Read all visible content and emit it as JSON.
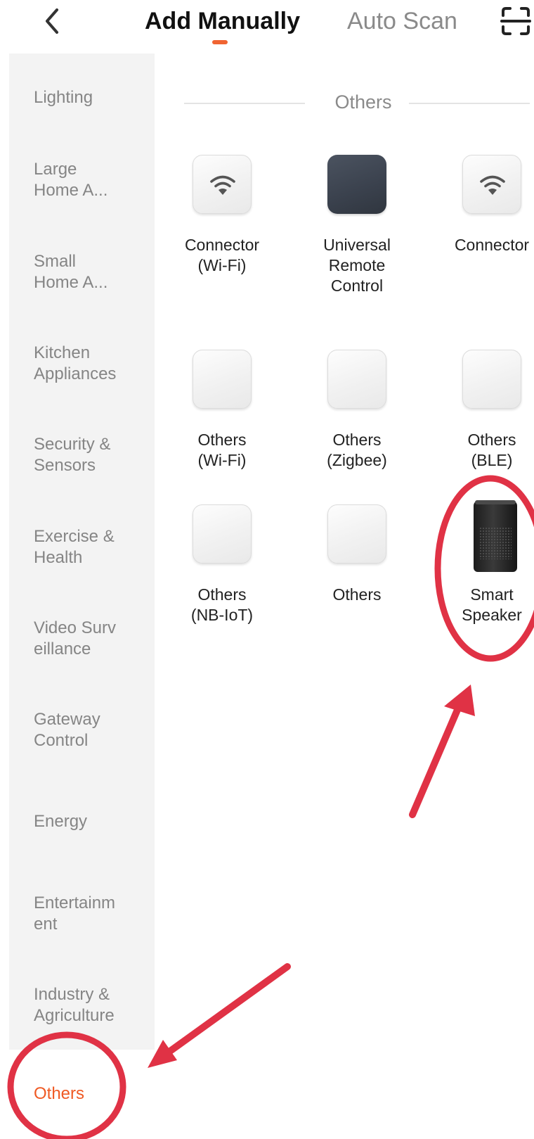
{
  "header": {
    "back_icon": "chevron-left-icon",
    "tabs": [
      {
        "label": "Add Manually",
        "active": true
      },
      {
        "label": "Auto Scan",
        "active": false
      }
    ],
    "scan_icon": "scan-frame-icon",
    "accent_color": "#f06432"
  },
  "sidebar": {
    "items": [
      {
        "label": "Lighting"
      },
      {
        "label": "Large\nHome A..."
      },
      {
        "label": "Small\nHome A..."
      },
      {
        "label": "Kitchen\nAppliances"
      },
      {
        "label": "Security &\nSensors"
      },
      {
        "label": "Exercise &\nHealth"
      },
      {
        "label": "Video Surv\neillance"
      },
      {
        "label": "Gateway\nControl"
      },
      {
        "label": "Energy"
      },
      {
        "label": "Entertainm\nent"
      },
      {
        "label": "Industry &\nAgriculture"
      },
      {
        "label": "Others",
        "selected": true
      }
    ]
  },
  "main": {
    "section_title": "Others",
    "devices": [
      {
        "label": "Connector\n(Wi-Fi)",
        "icon": "wifi-icon"
      },
      {
        "label": "Universal\nRemote\nControl",
        "icon": "remote-tile-icon"
      },
      {
        "label": "Connector",
        "icon": "wifi-icon"
      },
      {
        "label": "Others\n(Wi-Fi)",
        "icon": "blank-tile-icon"
      },
      {
        "label": "Others\n(Zigbee)",
        "icon": "blank-tile-icon"
      },
      {
        "label": "Others\n(BLE)",
        "icon": "blank-tile-icon"
      },
      {
        "label": "Others\n(NB-IoT)",
        "icon": "blank-tile-icon"
      },
      {
        "label": "Others",
        "icon": "blank-tile-icon"
      },
      {
        "label": "Smart\nSpeaker",
        "icon": "smart-speaker-icon"
      }
    ]
  },
  "annotations": {
    "color": "#e03245"
  }
}
